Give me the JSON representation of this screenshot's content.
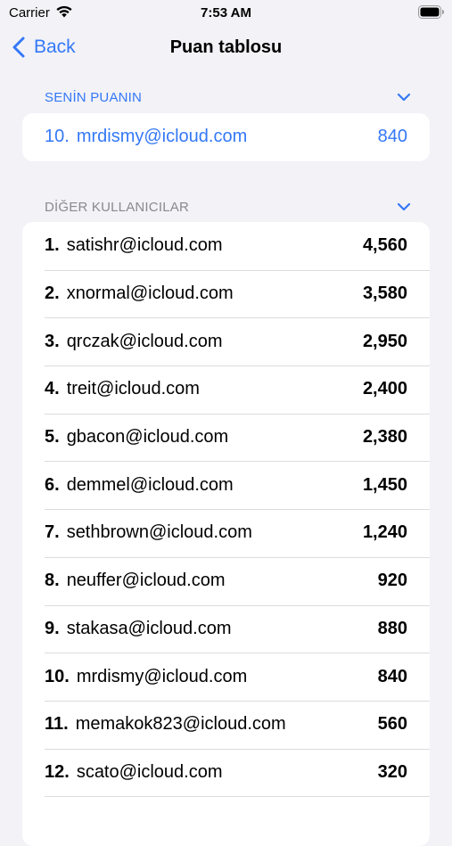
{
  "status": {
    "carrier": "Carrier",
    "time": "7:53 AM"
  },
  "nav": {
    "back_label": "Back",
    "title": "Puan tablosu"
  },
  "my_section": {
    "title": "SENİN PUANIN",
    "entry": {
      "rank": "10.",
      "email": "mrdismy@icloud.com",
      "score": "840"
    }
  },
  "others_section": {
    "title": "DİĞER KULLANICILAR",
    "entries": [
      {
        "rank": "1.",
        "email": "satishr@icloud.com",
        "score": "4,560"
      },
      {
        "rank": "2.",
        "email": "xnormal@icloud.com",
        "score": "3,580"
      },
      {
        "rank": "3.",
        "email": "qrczak@icloud.com",
        "score": "2,950"
      },
      {
        "rank": "4.",
        "email": "treit@icloud.com",
        "score": "2,400"
      },
      {
        "rank": "5.",
        "email": "gbacon@icloud.com",
        "score": "2,380"
      },
      {
        "rank": "6.",
        "email": "demmel@icloud.com",
        "score": "1,450"
      },
      {
        "rank": "7.",
        "email": "sethbrown@icloud.com",
        "score": "1,240"
      },
      {
        "rank": "8.",
        "email": "neuffer@icloud.com",
        "score": "920"
      },
      {
        "rank": "9.",
        "email": "stakasa@icloud.com",
        "score": "880"
      },
      {
        "rank": "10.",
        "email": "mrdismy@icloud.com",
        "score": "840"
      },
      {
        "rank": "11.",
        "email": "memakok823@icloud.com",
        "score": "560"
      },
      {
        "rank": "12.",
        "email": "scato@icloud.com",
        "score": "320"
      }
    ]
  },
  "colors": {
    "accent": "#3478f6",
    "background": "#f2f2f7",
    "section_header": "#8a8a8e"
  }
}
